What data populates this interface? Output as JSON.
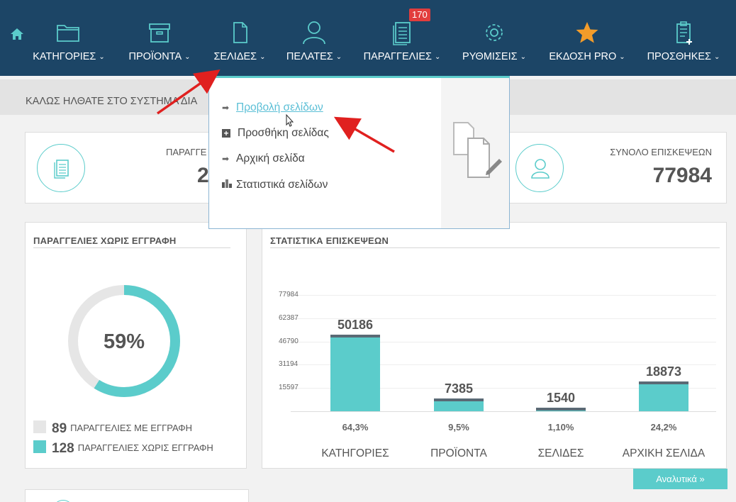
{
  "nav": {
    "items": [
      {
        "label": "ΚΑΤΗΓΟΡΙΕΣ",
        "icon": "folder-icon"
      },
      {
        "label": "ΠΡΟΪΟΝΤΑ",
        "icon": "archive-box-icon"
      },
      {
        "label": "ΣΕΛΙΔΕΣ",
        "icon": "page-icon"
      },
      {
        "label": "ΠΕΛΑΤΕΣ",
        "icon": "user-icon"
      },
      {
        "label": "ΠΑΡΑΓΓΕΛΙΕΣ",
        "icon": "orders-icon",
        "badge": "170"
      },
      {
        "label": "ΡΥΘΜΙΣΕΙΣ",
        "icon": "gear-icon"
      },
      {
        "label": "ΕΚΔΟΣΗ PRO",
        "icon": "star-icon"
      },
      {
        "label": "ΠΡΟΣΘΗΚΕΣ",
        "icon": "clipboard-add-icon"
      }
    ],
    "chevron": "⌄"
  },
  "welcome": {
    "text": "ΚΑΛΩΣ ΗΛΘΑΤΕ ΣΤΟ ΣΥΣΤΗΜΑ ΔΙΑ"
  },
  "stats": {
    "orders_label": "ΠΑΡΑΓΓΕ",
    "orders_value": "2",
    "visits_label": "ΣΥΝΟΛΟ ΕΠΙΣΚΕΨΕΩΝ",
    "visits_value": "77984"
  },
  "dropdown": {
    "items": [
      {
        "label": "Προβολή σελίδων",
        "icon": "arrow-right-icon"
      },
      {
        "label": "Προσθήκη σελίδας",
        "icon": "plus-square-icon"
      },
      {
        "label": "Αρχική σελίδα",
        "icon": "arrow-right-icon"
      },
      {
        "label": "Στατιστικά σελίδων",
        "icon": "bar-stats-icon"
      }
    ]
  },
  "orders_panel": {
    "title": "ΠΑΡΑΓΓΕΛΙΕΣ ΧΩΡΙΣ ΕΓΓΡΑΦΗ",
    "percent": "59%",
    "percent_value": 59,
    "legend": [
      {
        "count": "89",
        "label": "ΠΑΡΑΓΓΕΛΙΕΣ ΜΕ ΕΓΓΡΑΦΗ",
        "color": "#e6e6e6"
      },
      {
        "count": "128",
        "label": "ΠΑΡΑΓΓΕΛΙΕΣ ΧΩΡΙΣ ΕΓΓΡΑΦΗ",
        "color": "#5bcccb"
      }
    ]
  },
  "visits_panel": {
    "title": "ΣΤΑΤΙΣΤΙΚΑ ΕΠΙΣΚΕΨΕΩΝ",
    "button": "Αναλυτικά »"
  },
  "chart_data": {
    "type": "bar",
    "categories": [
      "ΚΑΤΗΓΟΡΙΕΣ",
      "ΠΡΟΪΟΝΤΑ",
      "ΣΕΛΙΔΕΣ",
      "ΑΡΧΙΚΗ ΣΕΛΙΔΑ"
    ],
    "values": [
      50186,
      7385,
      1540,
      18873
    ],
    "value_labels": [
      "50186",
      "7385",
      "1540",
      "18873"
    ],
    "percent_labels": [
      "64,3%",
      "9,5%",
      "1,10%",
      "24,2%"
    ],
    "y_ticks": [
      15597,
      31194,
      46790,
      62387,
      77984
    ],
    "ylim": [
      0,
      77984
    ],
    "title": "ΣΤΑΤΙΣΤΙΚΑ ΕΠΙΣΚΕΨΕΩΝ",
    "bar_color": "#5bcccb"
  }
}
